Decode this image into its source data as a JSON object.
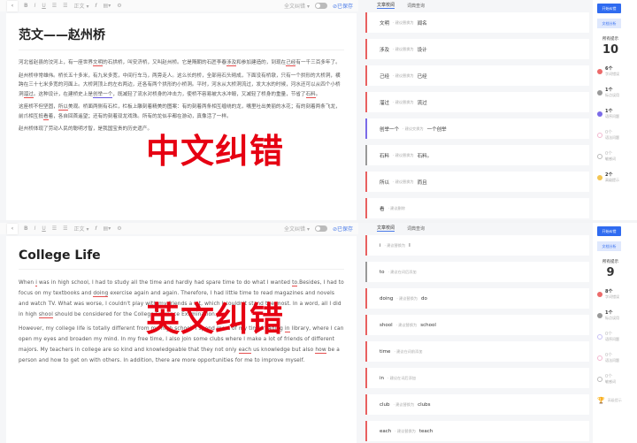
{
  "toolbar": {
    "style": "正文",
    "mode": "全文纠错",
    "saved": "已保存"
  },
  "tabs": [
    "文章校阅",
    "词典查询"
  ],
  "sidebar": {
    "start": "开始纠错",
    "analyze": "文档分析",
    "total_label": "所有提示"
  },
  "cn": {
    "title": "范文——赵州桥",
    "watermark": "中文纠错",
    "paragraphs": [
      [
        [
          "河北省赵县的洨河上，有一座世界",
          ""
        ],
        [
          "文明",
          "r"
        ],
        [
          "的石拱桥，叫安济桥，又叫赵州桥。它是隋朝的石匠李春",
          ""
        ],
        [
          "涉及",
          "r"
        ],
        [
          "和参加建造的，到现在",
          ""
        ],
        [
          "己经",
          "r"
        ],
        [
          "有一千三百多年了。",
          ""
        ]
      ],
      [
        [
          "赵州桥非常雄伟。桥长五十多米，有九米多宽，中间行车马，两旁走人。这么长的桥，全部用石头砌成，下面没有桥墩，只有一个拱形的大桥洞，横跨在三十七米多宽的河面上。大桥洞顶上的左右两边，还各有两个拱形的小桥洞。平时，河水从大桥洞流过，发大水的时候，河水还可以从四个小桥洞",
          ""
        ],
        [
          "溜过",
          "r"
        ],
        [
          "。这种设计，在建桥史上是",
          ""
        ],
        [
          "创举一个",
          "b"
        ],
        [
          "，既减轻了流水对桥身的冲击力，使桥不容易被大水冲毁，又减轻了桥身的重量，节省了",
          ""
        ],
        [
          "石料",
          "g"
        ],
        [
          "。",
          ""
        ]
      ],
      [
        [
          "这座桥不但坚固，",
          ""
        ],
        [
          "所以",
          "r"
        ],
        [
          "美观。桥面两侧有石栏，栏板上雕刻着精美的图案：有的刻着两条相互缠绕的龙，嘴里吐出美丽的水花；有的刻着两条飞龙，前爪相互抵",
          ""
        ],
        [
          "看",
          "r"
        ],
        [
          "着，各自回首遥望；还有的刻着双龙戏珠。所有的龙似乎都在游动，真像活了一样。",
          ""
        ]
      ],
      [
        [
          "赵州桥体现了劳动人民的聪明才智，是我国宝贵的历史遗产。",
          ""
        ]
      ]
    ],
    "suggestions": [
      {
        "word": "文明",
        "hint": "· 建议替换为",
        "fix": "闻名",
        "color": "#e86060"
      },
      {
        "word": "涉及",
        "hint": "· 建议替换为",
        "fix": "设计",
        "color": "#e86060"
      },
      {
        "word": "己经",
        "hint": "· 建议替换为",
        "fix": "已经",
        "color": "#e86060"
      },
      {
        "word": "溜过",
        "hint": "· 建议替换为",
        "fix": "流过",
        "color": "#e86060"
      },
      {
        "word": "创举一个",
        "hint": "· 建议交换为",
        "fix": "一个创举",
        "color": "#7b6be8"
      },
      {
        "word": "石料",
        "hint": "· 建议替换为",
        "fix": "石料。",
        "color": "#999999"
      },
      {
        "word": "所以",
        "hint": "· 建议替换为",
        "fix": "而且",
        "color": "#e86060"
      },
      {
        "word": "看",
        "hint": "· 建议删除",
        "fix": "",
        "color": "#e86060"
      }
    ],
    "total": "10",
    "categories": [
      {
        "count": "6个",
        "label": "字词错误",
        "color": "#ec6a6a",
        "zero": false
      },
      {
        "count": "1个",
        "label": "标点误用",
        "color": "#999999",
        "zero": false
      },
      {
        "count": "1个",
        "label": "语序问题",
        "color": "#7b6be8",
        "zero": false
      },
      {
        "count": "0个",
        "label": "语法问题",
        "color": "#f2b8d0",
        "zero": true
      },
      {
        "count": "0个",
        "label": "敏感词",
        "color": "#bbbbbb",
        "zero": true
      },
      {
        "count": "2个",
        "label": "高级提示",
        "color": "#f3c552",
        "zero": false
      }
    ]
  },
  "en": {
    "title": "College Life",
    "watermark": "英文纠错",
    "paragraphs": [
      [
        [
          "When ",
          ""
        ],
        [
          "i",
          "r"
        ],
        [
          " was in high school, I had to study all the time and hardly had spare time to do what I wanted ",
          ""
        ],
        [
          "to",
          "g"
        ],
        [
          ".Besides, I had to focus on my textbooks and ",
          ""
        ],
        [
          "doing",
          "r"
        ],
        [
          " exercise again and again. Therefore, I had little time to read magazines and novels and watch TV. What was worse, I couldn't play with my friends a lot, which I couldn't stand the most. In a word, all I did in high ",
          ""
        ],
        [
          "shool",
          "r"
        ],
        [
          " should be considered for the College Entrance Examination.",
          ""
        ]
      ],
      [
        [
          "However, my college life is totally different from my high school. I spend most of my time reading ",
          ""
        ],
        [
          "in",
          "r"
        ],
        [
          " library, where I can open my eyes and broaden my mind. In my free time, I also join some clubs where I make a lot of friends of different majors. My teachers in college are so kind and knowledgeable that they not only ",
          ""
        ],
        [
          "each",
          "r"
        ],
        [
          " us knowledge but also ",
          ""
        ],
        [
          "how",
          "r"
        ],
        [
          " be a person and how to get on with others. In addition, there are more opportunities for me to improve myself.",
          ""
        ]
      ]
    ],
    "suggestions": [
      {
        "word": "i",
        "hint": "· 建议替换为",
        "fix": "I",
        "color": "#e86060"
      },
      {
        "word": "to",
        "hint": "· 建议在词后添加",
        "fix": "",
        "color": "#999999"
      },
      {
        "word": "doing",
        "hint": "· 建议替换为",
        "fix": "do",
        "color": "#e86060"
      },
      {
        "word": "shool",
        "hint": "· 建议替换为",
        "fix": "school",
        "color": "#e86060"
      },
      {
        "word": "time",
        "hint": "· 建议在词前添加",
        "fix": "",
        "color": "#e86060"
      },
      {
        "word": "in",
        "hint": "· 建议在词后添加",
        "fix": "",
        "color": "#e86060"
      },
      {
        "word": "club",
        "hint": "· 建议替换为",
        "fix": "clubs",
        "color": "#e86060"
      },
      {
        "word": "each",
        "hint": "· 建议替换为",
        "fix": "teach",
        "color": "#e86060"
      }
    ],
    "total": "9",
    "categories": [
      {
        "count": "8个",
        "label": "字词错误",
        "color": "#ec6a6a",
        "zero": false
      },
      {
        "count": "1个",
        "label": "标点误用",
        "color": "#999999",
        "zero": false
      },
      {
        "count": "0个",
        "label": "语序问题",
        "color": "#c9c2f5",
        "zero": true
      },
      {
        "count": "0个",
        "label": "语法问题",
        "color": "#f2b8d0",
        "zero": true
      },
      {
        "count": "0个",
        "label": "敏感词",
        "color": "#bbbbbb",
        "zero": true
      }
    ],
    "advanced": "高级提示"
  }
}
